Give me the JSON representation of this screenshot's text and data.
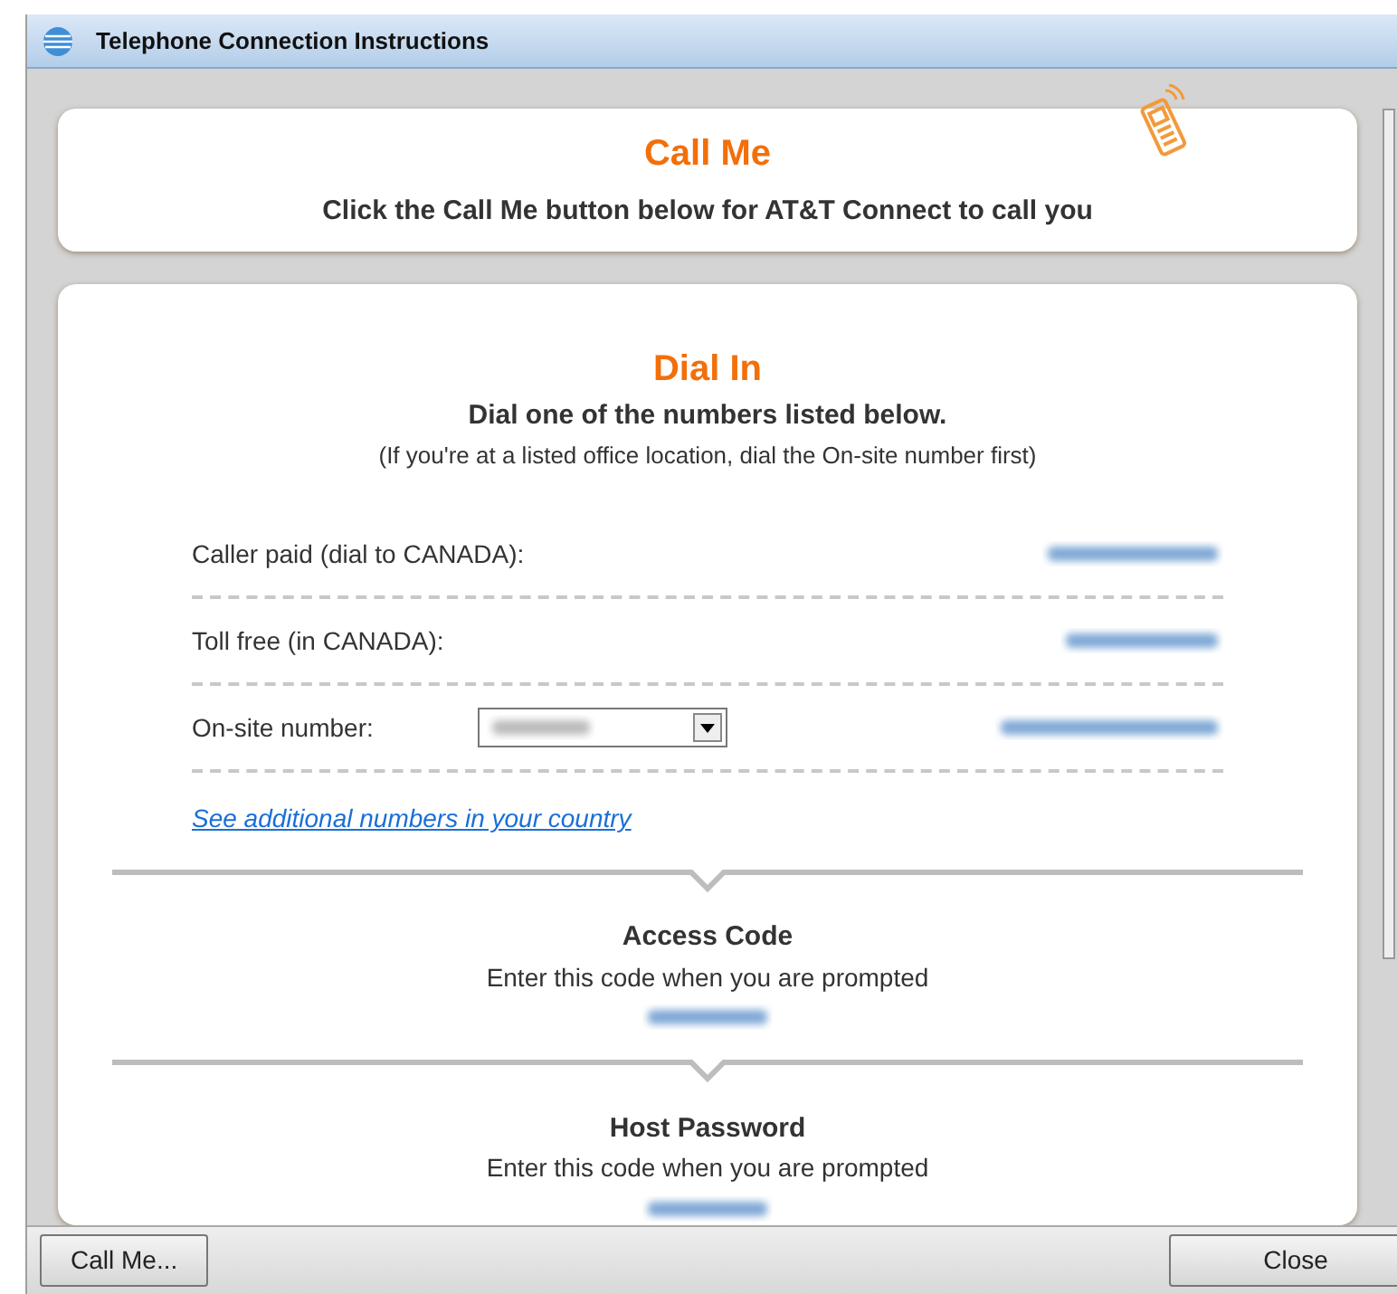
{
  "window": {
    "title": "Telephone Connection Instructions"
  },
  "call_me": {
    "title": "Call Me",
    "text": "Click the Call Me button below for AT&T Connect to call you"
  },
  "dial_in": {
    "title": "Dial In",
    "subtitle": "Dial one of the numbers listed below.",
    "note": "(If you're at a listed office location, dial the On-site number first)",
    "rows": [
      {
        "kind": "number",
        "label": "Caller paid (dial to CANADA):"
      },
      {
        "kind": "number",
        "label": "Toll free (in CANADA):"
      },
      {
        "kind": "select",
        "label": "On-site number:"
      }
    ],
    "link": "See additional numbers in your country",
    "codes": [
      {
        "title": "Access Code",
        "text": "Enter this code when you are prompted"
      },
      {
        "title": "Host Password",
        "text": "Enter this code when you are prompted"
      }
    ]
  },
  "buttons": [
    {
      "label": "Call Me..."
    },
    {
      "label": "Close"
    }
  ]
}
